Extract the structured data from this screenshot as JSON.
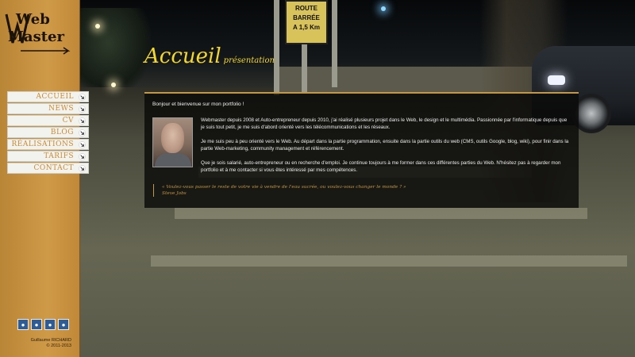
{
  "sidebar": {
    "logo": {
      "line1": "Web",
      "line2": "Master"
    },
    "menu": [
      {
        "label": "ACCUEIL"
      },
      {
        "label": "NEWS"
      },
      {
        "label": "CV"
      },
      {
        "label": "BLOG"
      },
      {
        "label": "RÉALISATIONS"
      },
      {
        "label": "TARIFS"
      },
      {
        "label": "CONTACT"
      }
    ],
    "social": [
      {
        "icon": "social-icon-1"
      },
      {
        "icon": "social-icon-2"
      },
      {
        "icon": "social-icon-3"
      },
      {
        "icon": "social-icon-4"
      }
    ],
    "credit": {
      "name": "Guillaume RICHARD",
      "years": "© 2011-2013"
    }
  },
  "background": {
    "sign_line1": "ROUTE",
    "sign_line2": "BARRÉE",
    "sign_line3": "A 1,5 Km"
  },
  "main": {
    "title": "Accueil",
    "subtitle": "présentation",
    "greeting": "Bonjour et bienvenue sur mon portfolio !",
    "paragraphs": [
      "Webmaster depuis 2008 et Auto-entrepreneur depuis 2010, j'ai réalisé plusieurs projet dans le Web, le design et le multimédia. Passionnée par l'informatique depuis que je suis tout petit, je me suis d'abord orienté vers les télécommunications et les réseaux.",
      "Je me suis peu à peu orienté vers le Web. Au départ dans la partie programmation, ensuite dans la partie outils du web (CMS, outils Google, blog, wiki), pour finir dans la partie Web-marketing, community management et référencement.",
      "Que je sois salarié, auto-entrepreneur ou en recherche d'emploi. Je continue toujours à me former dans ces différentes parties du Web. N'hésitez pas à regarder mon portfolio et à me contacter si vous êtes intéressé par mes compétences."
    ],
    "quote": "« Voulez-vous passer le reste de votre vie à vendre de l'eau sucrée, ou voulez-vous changer le monde ? »",
    "quote_author": "Steve Jobs"
  },
  "colors": {
    "sidebar": "#c89440",
    "accent": "#c59740",
    "title": "#f4d82a",
    "menu_text": "#cc8a2e"
  }
}
